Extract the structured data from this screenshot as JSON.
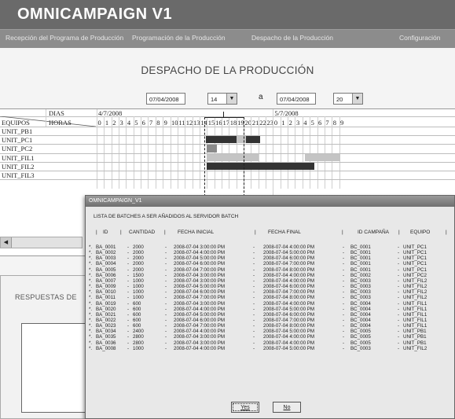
{
  "app": {
    "brand": "OMNICAMPAIGN V1"
  },
  "nav": [
    "Recepción del Programa de Producción",
    "Programación de la Producción",
    "Despacho de la Producción",
    "Configuración"
  ],
  "page": {
    "title": "DESPACHO DE LA PRODUCCIÓN"
  },
  "filters": {
    "date_from": "07/04/2008",
    "hour_from": "14",
    "sep": "a",
    "date_to": "07/04/2008",
    "hour_to": "20"
  },
  "gantt": {
    "corner_top": "DIAS",
    "corner_left": "EQUIPOS",
    "corner_right": "HORAS",
    "day1": "4/7/2008",
    "day2": "5/7/2008",
    "hours_day1": [
      "0",
      "1",
      "2",
      "3",
      "4",
      "5",
      "6",
      "7",
      "8",
      "9",
      "10",
      "11",
      "12",
      "13",
      "14",
      "15",
      "16",
      "17",
      "18",
      "19",
      "20",
      "21",
      "22",
      "23"
    ],
    "hours_day2": [
      "0",
      "1",
      "2",
      "3",
      "4",
      "5",
      "6",
      "7",
      "8",
      "9"
    ],
    "equipment": [
      "UNIT_PB1",
      "UNIT_PC1",
      "UNIT_PC2",
      "UNIT_FIL1",
      "UNIT_FIL2",
      "UNIT_FIL3"
    ],
    "bar_colors": {
      "dark": "#333333",
      "mid": "#8a8a8a",
      "light": "#c4c4c4"
    }
  },
  "responses": {
    "label": "RESPUESTAS DE"
  },
  "dialog": {
    "title": "OMNICAMPAIGN_V1",
    "subtitle": "LISTA DE BATCHES A SER AÑADIDOS AL SERVIDOR BATCH",
    "headers": [
      "ID",
      "CANTIDAD",
      "FECHA INICIAL",
      "FECHA FINAL",
      "ID CAMPAÑA",
      "EQUIPO"
    ],
    "rows": [
      [
        "BA_0001",
        "2000",
        "2008-07-04 3:00:00 PM",
        "2008-07-04 4:00:00 PM",
        "BC_0001",
        "UNIT_PC1"
      ],
      [
        "BA_0002",
        "2000",
        "2008-07-04 4:00:00 PM",
        "2008-07-04 5:00:00 PM",
        "BC_0001",
        "UNIT_PC1"
      ],
      [
        "BA_0003",
        "2000",
        "2008-07-04 5:00:00 PM",
        "2008-07-04 6:00:00 PM",
        "BC_0001",
        "UNIT_PC1"
      ],
      [
        "BA_0004",
        "2000",
        "2008-07-04 6:00:00 PM",
        "2008-07-04 7:00:00 PM",
        "BC_0001",
        "UNIT_PC1"
      ],
      [
        "BA_0005",
        "2000",
        "2008-07-04 7:00:00 PM",
        "2008-07-04 8:00:00 PM",
        "BC_0001",
        "UNIT_PC1"
      ],
      [
        "BA_0006",
        "1500",
        "2008-07-04 3:00:00 PM",
        "2008-07-04 4:00:00 PM",
        "BC_0002",
        "UNIT_PC2"
      ],
      [
        "BA_0007",
        "1000",
        "2008-07-04 3:00:00 PM",
        "2008-07-04 4:00:00 PM",
        "BC_0003",
        "UNIT_FIL2"
      ],
      [
        "BA_0009",
        "1000",
        "2008-07-04 5:00:00 PM",
        "2008-07-04 6:00:00 PM",
        "BC_0003",
        "UNIT_FIL2"
      ],
      [
        "BA_0010",
        "1000",
        "2008-07-04 6:00:00 PM",
        "2008-07-04 7:00:00 PM",
        "BC_0003",
        "UNIT_FIL2"
      ],
      [
        "BA_0011",
        "1000",
        "2008-07-04 7:00:00 PM",
        "2008-07-04 8:00:00 PM",
        "BC_0003",
        "UNIT_FIL2"
      ],
      [
        "BA_0019",
        "600",
        "2008-07-04 3:00:00 PM",
        "2008-07-04 4:00:00 PM",
        "BC_0004",
        "UNIT_FIL1"
      ],
      [
        "BA_0020",
        "600",
        "2008-07-04 4:00:00 PM",
        "2008-07-04 5:00:00 PM",
        "BC_0004",
        "UNIT_FIL1"
      ],
      [
        "BA_0021",
        "600",
        "2008-07-04 5:00:00 PM",
        "2008-07-04 6:00:00 PM",
        "BC_0004",
        "UNIT_FIL1"
      ],
      [
        "BA_0022",
        "600",
        "2008-07-04 6:00:00 PM",
        "2008-07-04 7:00:00 PM",
        "BC_0004",
        "UNIT_FIL1"
      ],
      [
        "BA_0023",
        "600",
        "2008-07-04 7:00:00 PM",
        "2008-07-04 8:00:00 PM",
        "BC_0004",
        "UNIT_FIL1"
      ],
      [
        "BA_0034",
        "2400",
        "2008-07-04 4:00:00 PM",
        "2008-07-04 5:00:00 PM",
        "BC_0005",
        "UNIT_PB1"
      ],
      [
        "BA_0035",
        "2800",
        "2008-07-04 3:00:00 PM",
        "2008-07-04 4:00:00 PM",
        "BC_0005",
        "UNIT_PB1"
      ],
      [
        "BA_0036",
        "2800",
        "2008-07-04 3:00:00 PM",
        "2008-07-04 4:00:00 PM",
        "BC_0005",
        "UNIT_PB1"
      ],
      [
        "BA_0008",
        "1000",
        "2008-07-04 4:00:00 PM",
        "2008-07-04 5:00:00 PM",
        "BC_0003",
        "UNIT_FIL2"
      ]
    ],
    "yes_label": "Yes",
    "no_label": "No"
  }
}
